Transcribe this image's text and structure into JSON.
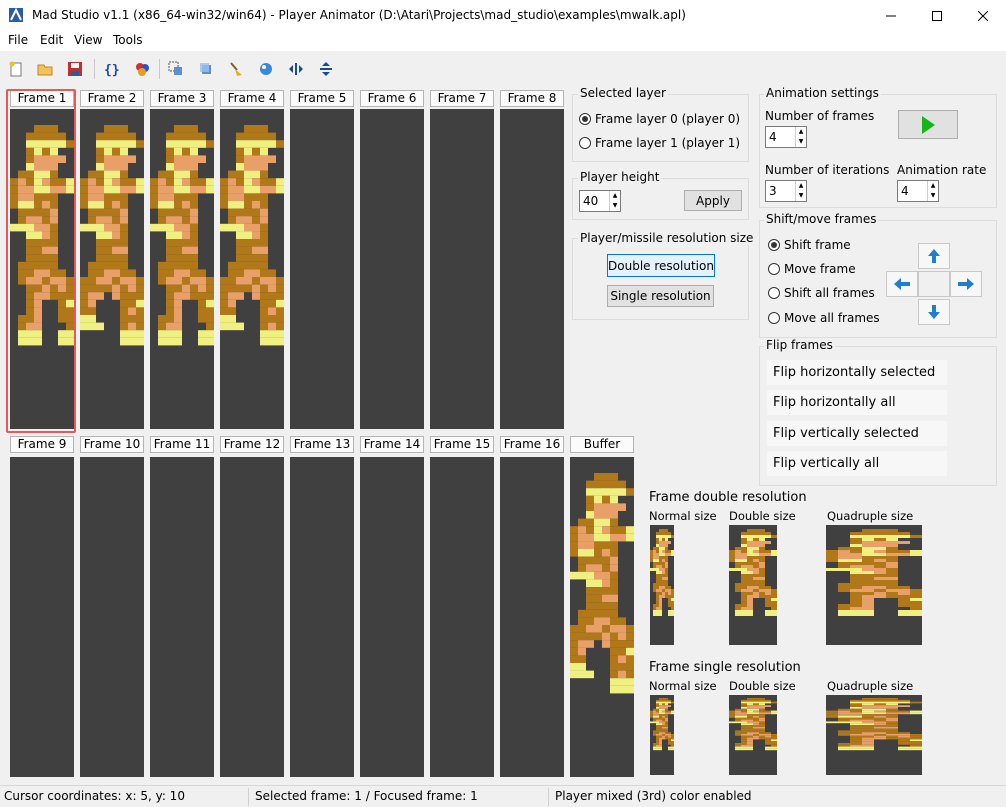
{
  "window": {
    "title": "Mad Studio  v1.1 (x86_64-win32/win64) - Player Animator (D:\\Atari\\Projects\\mad_studio\\examples\\mwalk.apl)"
  },
  "menu": {
    "file": "File",
    "edit": "Edit",
    "view": "View",
    "tools": "Tools"
  },
  "toolbar_icons": [
    "new-file-icon",
    "open-folder-icon",
    "save-disk-icon",
    "braces-icon",
    "palette-icon",
    "select-icon",
    "layers-icon",
    "clear-brush-icon",
    "color-ball-icon",
    "flip-horizontal-icon",
    "flip-vertical-icon"
  ],
  "colors": {
    "canvas": "#404040",
    "dark": "#b07818",
    "light": "#e8a068",
    "yellow": "#f0f080",
    "selection": "#e45a5a"
  },
  "frames_top": [
    "Frame 1",
    "Frame 2",
    "Frame 3",
    "Frame 4",
    "Frame 5",
    "Frame 6",
    "Frame 7",
    "Frame 8"
  ],
  "frames_bottom": [
    "Frame 9",
    "Frame 10",
    "Frame 11",
    "Frame 12",
    "Frame 13",
    "Frame 14",
    "Frame 15",
    "Frame 16"
  ],
  "buffer_label": "Buffer",
  "selected_layer": {
    "title": "Selected layer",
    "layer0": "Frame layer 0 (player 0)",
    "layer1": "Frame layer 1 (player 1)"
  },
  "player_height": {
    "title": "Player height",
    "value": "40",
    "apply": "Apply"
  },
  "resolution": {
    "title": "Player/missile resolution size",
    "double": "Double resolution",
    "single": "Single resolution"
  },
  "animation": {
    "title": "Animation settings",
    "frames_label": "Number of frames",
    "frames_value": "4",
    "iterations_label": "Number of iterations",
    "iterations_value": "3",
    "rate_label": "Animation rate",
    "rate_value": "4"
  },
  "shift": {
    "title": "Shift/move frames",
    "shift_frame": "Shift frame",
    "move_frame": "Move frame",
    "shift_all": "Shift all frames",
    "move_all": "Move all frames"
  },
  "flip": {
    "title": "Flip frames",
    "h_selected": "Flip horizontally selected",
    "h_all": "Flip horizontally all",
    "v_selected": "Flip vertically selected",
    "v_all": "Flip vertically all"
  },
  "preview_double": {
    "title": "Frame double resolution",
    "normal": "Normal size",
    "double": "Double size",
    "quadruple": "Quadruple size"
  },
  "preview_single": {
    "title": "Frame single resolution",
    "normal": "Normal size",
    "double": "Double size",
    "quadruple": "Quadruple size"
  },
  "status": {
    "cursor": "Cursor coordinates: x: 5, y: 10",
    "frame": "Selected frame: 1 / Focused frame: 1",
    "color": "Player mixed (3rd) color enabled"
  }
}
